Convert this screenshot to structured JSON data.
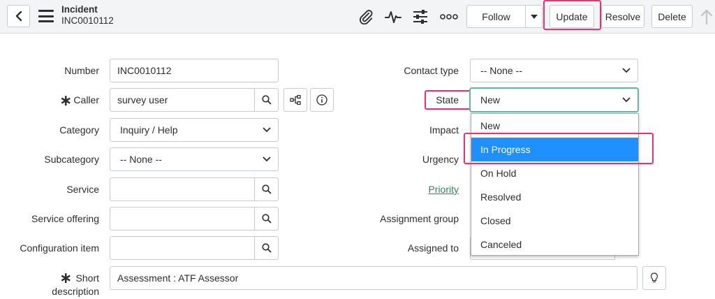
{
  "header": {
    "title": "Incident",
    "number": "INC0010112",
    "follow_label": "Follow",
    "update_label": "Update",
    "resolve_label": "Resolve",
    "delete_label": "Delete",
    "icons": [
      "chevron-left-icon",
      "hamburger-icon",
      "paperclip-icon",
      "activity-icon",
      "sliders-icon",
      "more-icon",
      "caret-down-icon",
      "up-arrow-icon"
    ]
  },
  "form": {
    "number": {
      "label": "Number",
      "value": "INC0010112"
    },
    "caller": {
      "label": "Caller",
      "value": "survey user"
    },
    "category": {
      "label": "Category",
      "value": "Inquiry / Help"
    },
    "subcategory": {
      "label": "Subcategory",
      "value": "-- None --"
    },
    "service": {
      "label": "Service",
      "value": ""
    },
    "service_offering": {
      "label": "Service offering",
      "value": ""
    },
    "configuration_item": {
      "label": "Configuration item",
      "value": ""
    },
    "short_description": {
      "label_line1": "Short",
      "label_line2": "description",
      "value": "Assessment :  ATF Assessor"
    },
    "contact_type": {
      "label": "Contact type",
      "value": "-- None --"
    },
    "state": {
      "label": "State",
      "value": "New"
    },
    "impact": {
      "label": "Impact"
    },
    "urgency": {
      "label": "Urgency"
    },
    "priority": {
      "label": "Priority"
    },
    "assignment_group": {
      "label": "Assignment group"
    },
    "assigned_to": {
      "label": "Assigned to"
    }
  },
  "state_dropdown": {
    "options": [
      "New",
      "In Progress",
      "On Hold",
      "Resolved",
      "Closed",
      "Canceled"
    ],
    "highlighted": "In Progress"
  },
  "colors": {
    "highlight_box": "#e8336d",
    "dropdown_active": "#1e90ff",
    "header_bg": "#f3f4f5",
    "link_green": "#2e8b57"
  }
}
